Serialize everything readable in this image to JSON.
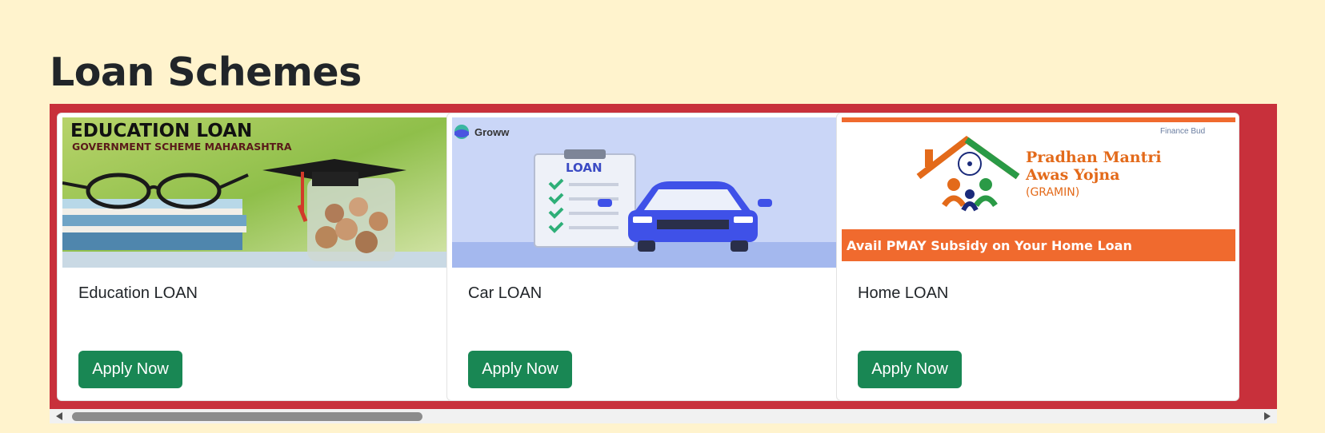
{
  "section": {
    "title": "Loan Schemes"
  },
  "cards": [
    {
      "title": "Education LOAN",
      "button": "Apply Now",
      "image": {
        "line1": "EDUCATION LOAN",
        "line2": "GOVERNMENT SCHEME MAHARASHTRA"
      }
    },
    {
      "title": "Car LOAN",
      "button": "Apply Now",
      "image": {
        "brand": "Groww",
        "board_text": "LOAN"
      }
    },
    {
      "title": "Home LOAN",
      "button": "Apply Now",
      "image": {
        "line1": "Pradhan Mantri",
        "line2": "Awas Yojna",
        "line3": "(GRAMIN)",
        "banner": "Avail PMAY Subsidy on Your Home Loan",
        "corner": "Finance Bud"
      }
    }
  ],
  "colors": {
    "page_bg": "#fff3cd",
    "carousel_bg": "#c8303b",
    "button_bg": "#198754",
    "title_text": "#212529"
  }
}
